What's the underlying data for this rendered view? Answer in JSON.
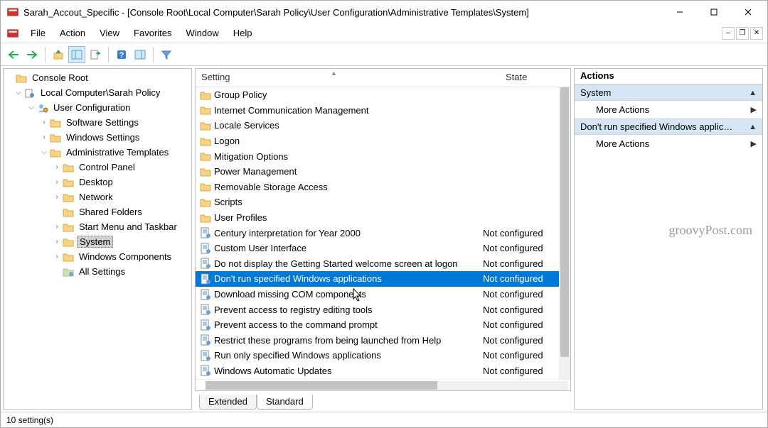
{
  "window": {
    "title": "Sarah_Accout_Specific - [Console Root\\Local Computer\\Sarah Policy\\User Configuration\\Administrative Templates\\System]"
  },
  "menu": {
    "file": "File",
    "action": "Action",
    "view": "View",
    "favorites": "Favorites",
    "window": "Window",
    "help": "Help"
  },
  "tree": {
    "root": "Console Root",
    "policy": "Local Computer\\Sarah Policy",
    "userconfig": "User Configuration",
    "software": "Software Settings",
    "windows_settings": "Windows Settings",
    "admin_templates": "Administrative Templates",
    "control_panel": "Control Panel",
    "desktop": "Desktop",
    "network": "Network",
    "shared_folders": "Shared Folders",
    "start_menu": "Start Menu and Taskbar",
    "system": "System",
    "windows_components": "Windows Components",
    "all_settings": "All Settings"
  },
  "list": {
    "col_setting": "Setting",
    "col_state": "State",
    "rows": [
      {
        "type": "folder",
        "name": "Group Policy",
        "state": ""
      },
      {
        "type": "folder",
        "name": "Internet Communication Management",
        "state": ""
      },
      {
        "type": "folder",
        "name": "Locale Services",
        "state": ""
      },
      {
        "type": "folder",
        "name": "Logon",
        "state": ""
      },
      {
        "type": "folder",
        "name": "Mitigation Options",
        "state": ""
      },
      {
        "type": "folder",
        "name": "Power Management",
        "state": ""
      },
      {
        "type": "folder",
        "name": "Removable Storage Access",
        "state": ""
      },
      {
        "type": "folder",
        "name": "Scripts",
        "state": ""
      },
      {
        "type": "folder",
        "name": "User Profiles",
        "state": ""
      },
      {
        "type": "setting",
        "name": "Century interpretation for Year 2000",
        "state": "Not configured"
      },
      {
        "type": "setting",
        "name": "Custom User Interface",
        "state": "Not configured"
      },
      {
        "type": "setting",
        "name": "Do not display the Getting Started welcome screen at logon",
        "state": "Not configured"
      },
      {
        "type": "setting",
        "name": "Don't run specified Windows applications",
        "state": "Not configured",
        "selected": true
      },
      {
        "type": "setting",
        "name": "Download missing COM components",
        "state": "Not configured"
      },
      {
        "type": "setting",
        "name": "Prevent access to registry editing tools",
        "state": "Not configured"
      },
      {
        "type": "setting",
        "name": "Prevent access to the command prompt",
        "state": "Not configured"
      },
      {
        "type": "setting",
        "name": "Restrict these programs from being launched from Help",
        "state": "Not configured"
      },
      {
        "type": "setting",
        "name": "Run only specified Windows applications",
        "state": "Not configured"
      },
      {
        "type": "setting",
        "name": "Windows Automatic Updates",
        "state": "Not configured"
      }
    ]
  },
  "tabs": {
    "extended": "Extended",
    "standard": "Standard"
  },
  "actions": {
    "header": "Actions",
    "group1": "System",
    "more1": "More Actions",
    "group2": "Don't run specified Windows applicat...",
    "more2": "More Actions"
  },
  "watermark": "groovyPost.com",
  "status": "10 setting(s)"
}
